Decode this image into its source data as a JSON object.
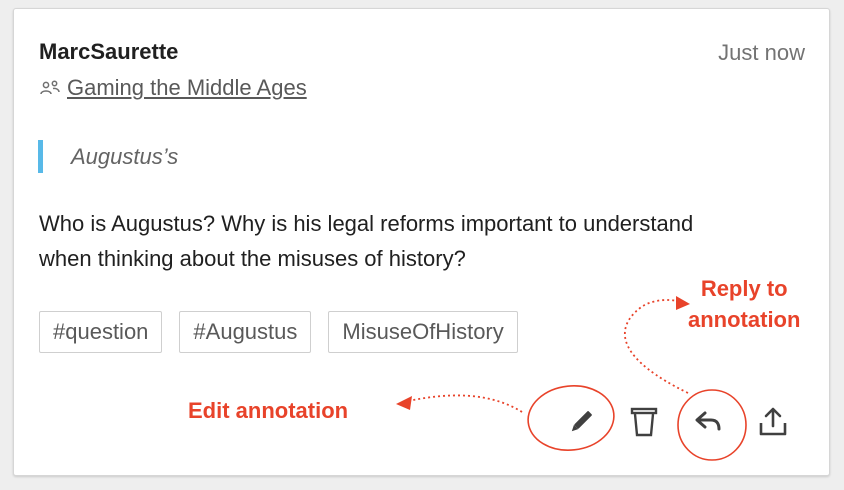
{
  "annotation": {
    "user": "MarcSaurette",
    "timestamp": "Just now",
    "group": {
      "icon": "group-icon",
      "name": "Gaming the Middle Ages"
    },
    "quote": "Augustus’s",
    "body": "Who is Augustus? Why is his legal reforms important to understand when thinking about the misuses of history?",
    "tags": [
      "#question",
      "#Augustus",
      "MisuseOfHistory"
    ],
    "actions": [
      {
        "name": "edit",
        "icon": "pencil-icon"
      },
      {
        "name": "delete",
        "icon": "trash-icon"
      },
      {
        "name": "reply",
        "icon": "reply-icon"
      },
      {
        "name": "share",
        "icon": "share-icon"
      }
    ]
  },
  "callouts": {
    "edit_label": "Edit annotation",
    "reply_label_line1": "Reply to",
    "reply_label_line2": "annotation",
    "color": "#e8432a"
  },
  "colors": {
    "quote_bar": "#58b9e8",
    "text": "#202020",
    "muted": "#737373"
  }
}
